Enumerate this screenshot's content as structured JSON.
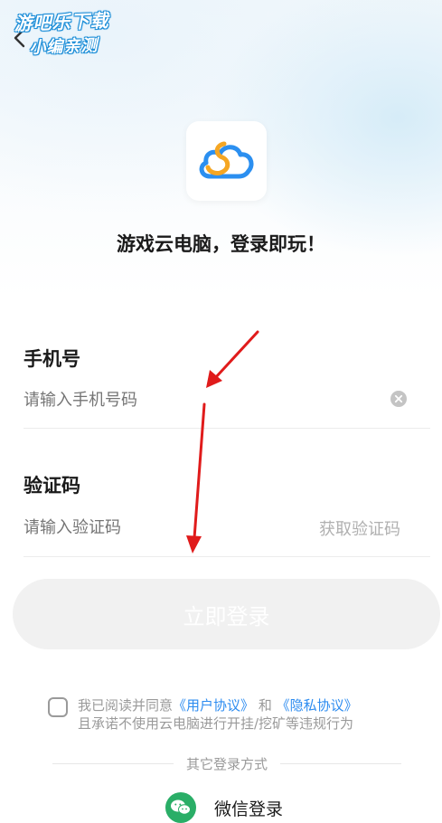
{
  "watermark": {
    "line1": "游吧乐下载",
    "line2": "小编亲测"
  },
  "header": {
    "back_icon": "chevron-left-icon"
  },
  "logo": {
    "icon": "cloud-logo-icon",
    "colors": [
      "#2b8ff0",
      "#f5a623"
    ]
  },
  "slogan": "游戏云电脑，登录即玩！",
  "phone": {
    "label": "手机号",
    "placeholder": "请输入手机号码",
    "clear_icon": "clear-circle-icon"
  },
  "code": {
    "label": "验证码",
    "placeholder": "请输入验证码",
    "get_code": "获取验证码"
  },
  "login_button": "立即登录",
  "agreement": {
    "prefix": "我已阅读并同意",
    "user_agreement": "《用户协议》",
    "and": "和",
    "privacy_agreement": "《隐私协议》",
    "line2": "且承诺不使用云电脑进行开挂/挖矿等违规行为"
  },
  "other_login": {
    "label": "其它登录方式",
    "wechat_label": "微信登录",
    "wechat_icon": "wechat-icon"
  },
  "colors": {
    "accent": "#2d8cf0",
    "wechat": "#2aae67",
    "arrow": "#e01b1b"
  }
}
